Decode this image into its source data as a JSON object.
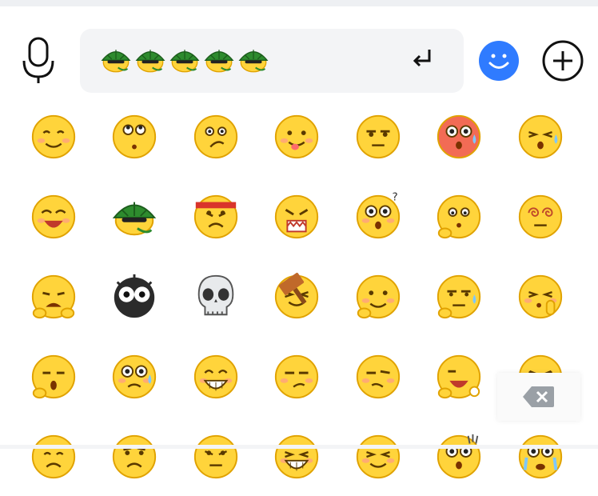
{
  "keyboard": {
    "input_emojis": [
      "turtle",
      "turtle",
      "turtle",
      "turtle",
      "turtle"
    ],
    "icons": {
      "voice": "microphone-icon",
      "enter": "enter-arrow-icon",
      "emoji_toggle": "smile-icon",
      "more": "plus-icon",
      "delete": "backspace-icon"
    },
    "accent_color": "#2f7bff"
  },
  "emoji_grid": [
    "smile",
    "rolling-eyes",
    "frown",
    "tongue",
    "neutral",
    "shocked-red",
    "sweat",
    "laughing",
    "turtle",
    "angry-headband",
    "furious",
    "confused",
    "awkward",
    "dizzy",
    "crying",
    "black-ball",
    "skull",
    "hammer",
    "hand-smile",
    "facepalm",
    "pick-nose",
    "yawn",
    "sweat-blush",
    "grimace",
    "smirk-left",
    "smirk-right",
    "scared",
    "squint",
    "worried",
    "sad",
    "speechless",
    "grin-1",
    "grin-2",
    "shocked",
    "sob"
  ]
}
